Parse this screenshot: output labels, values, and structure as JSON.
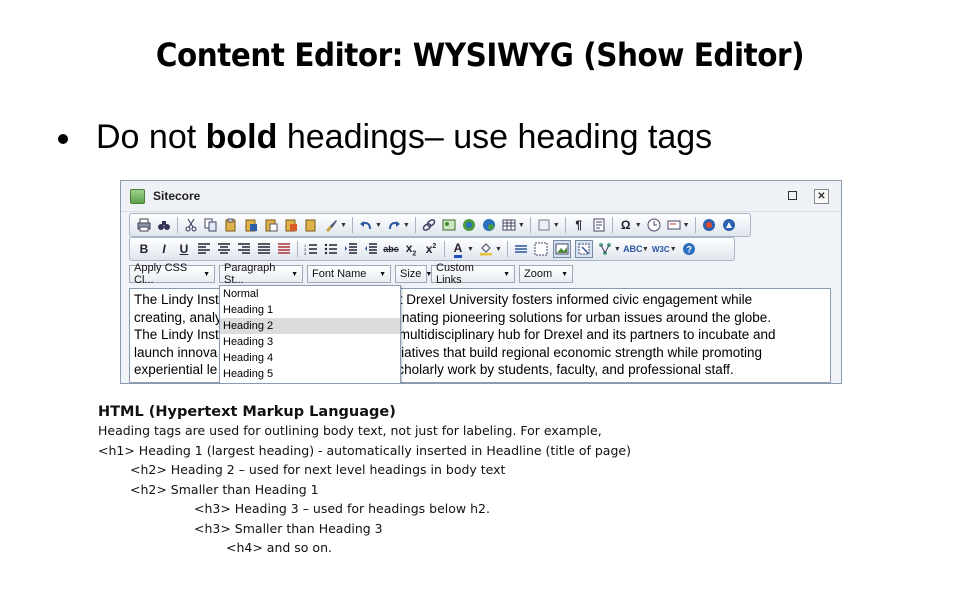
{
  "slide": {
    "title": "Content Editor: WYSIWYG (Show Editor)",
    "bullet_prefix": "Do not ",
    "bullet_bold": "bold",
    "bullet_suffix": " headings– use heading tags"
  },
  "window": {
    "title": "Sitecore",
    "toolbar2": {
      "bold": "B",
      "italic": "I",
      "underline": "U"
    },
    "dropdowns": [
      {
        "label": "Apply CSS Cl..."
      },
      {
        "label": "Paragraph St..."
      },
      {
        "label": "Font Name"
      },
      {
        "label": "Size"
      },
      {
        "label": "Custom Links"
      },
      {
        "label": "Zoom"
      }
    ],
    "editor_lines": [
      "The Lindy Inst",
      "creating, analy",
      "The Lindy Inst",
      "launch innova",
      "experiential le"
    ],
    "editor_lines_right": [
      "t Drexel University fosters informed civic engagement while",
      "nating pioneering solutions for urban issues around the globe.",
      "multidisciplinary hub for Drexel and its partners to incubate and",
      "tiatives that build regional economic strength while promoting",
      "cholarly work by students, faculty, and professional staff."
    ],
    "paragraph_menu": [
      "Normal",
      "Heading 1",
      "Heading 2",
      "Heading 3",
      "Heading 4",
      "Heading 5"
    ],
    "paragraph_menu_selected": "Heading 2"
  },
  "html_notes": {
    "heading": "HTML (Hypertext Markup Language)",
    "intro": "Heading tags are used for outlining body text, not just for labeling. For example,",
    "lines": [
      "<h1> Heading 1 (largest heading) - automatically inserted in Headline (title of page)",
      "<h2> Heading 2 – used for next level headings in body text",
      "<h2> Smaller than Heading 1",
      "<h3> Heading 3 – used for headings below h2.",
      "<h3> Smaller than Heading 3",
      "<h4> and so on."
    ]
  }
}
